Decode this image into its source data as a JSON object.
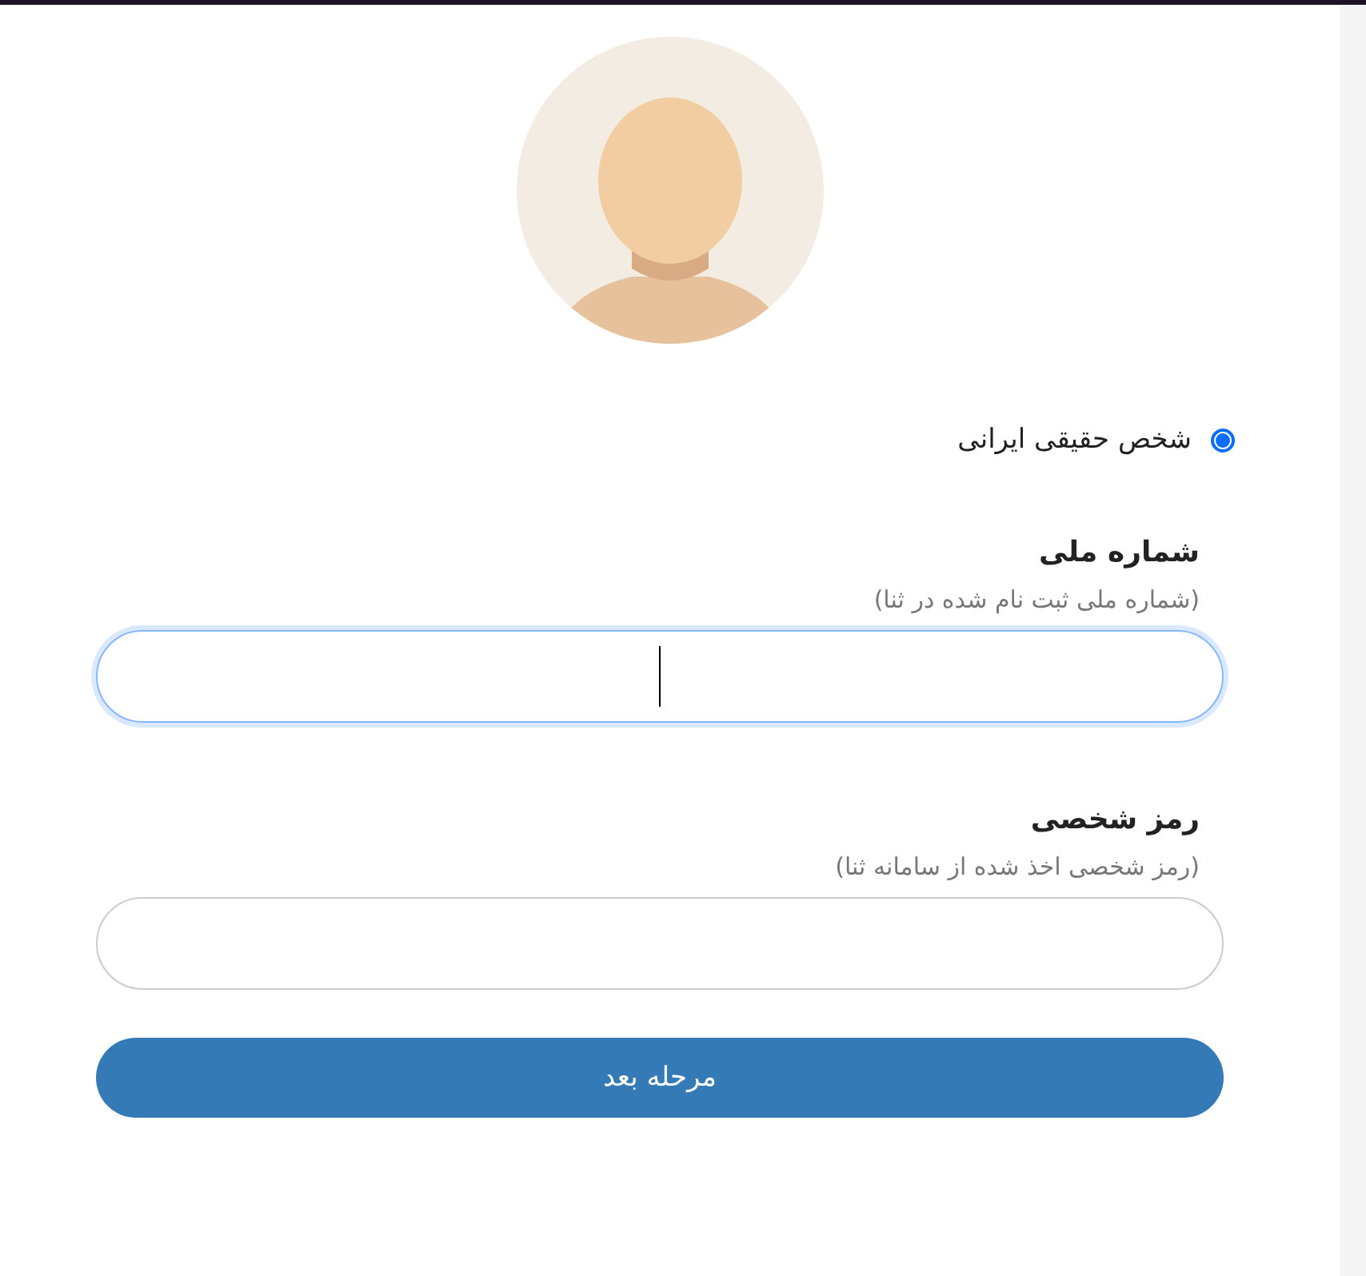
{
  "person_types": [
    {
      "label": "شخص حقیقی ایرانی",
      "selected": true
    }
  ],
  "fields": [
    {
      "label": "شماره ملی",
      "hint": "(شماره ملی ثبت نام شده در ثنا)",
      "focused": true
    },
    {
      "label": "رمز شخصی",
      "hint": "(رمز شخصی اخذ شده از سامانه ثنا)",
      "focused": false
    }
  ],
  "submit_button": "مرحله بعد"
}
